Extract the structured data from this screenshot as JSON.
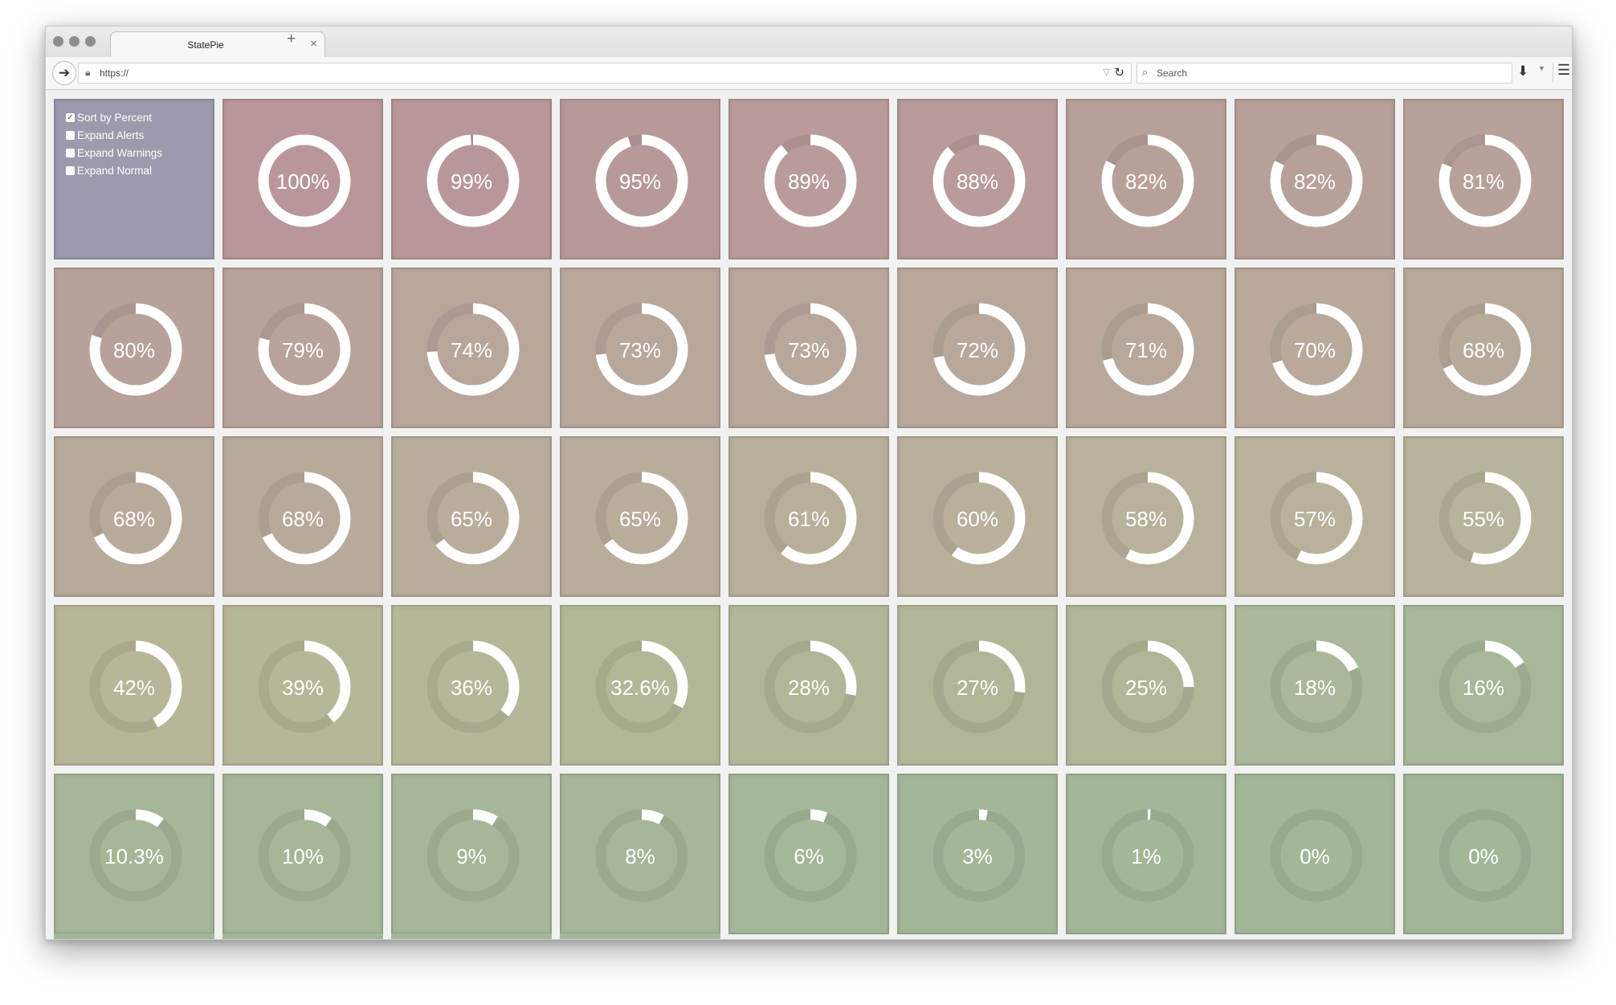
{
  "browser": {
    "tab_title": "StatePie",
    "tab_close": "×",
    "new_tab": "+",
    "url": "https://",
    "search_placeholder": "Search"
  },
  "controls": [
    {
      "label": "Sort by Percent",
      "checked": true
    },
    {
      "label": "Expand Alerts",
      "checked": false
    },
    {
      "label": "Expand Warnings",
      "checked": false
    },
    {
      "label": "Expand Normal",
      "checked": false
    }
  ],
  "pies": [
    {
      "label": "100%",
      "value": 100,
      "color": "#b89699"
    },
    {
      "label": "99%",
      "value": 99,
      "color": "#b8979a"
    },
    {
      "label": "95%",
      "value": 95,
      "color": "#b8999a"
    },
    {
      "label": "89%",
      "value": 89,
      "color": "#b89b9a"
    },
    {
      "label": "88%",
      "value": 88,
      "color": "#b89b9a"
    },
    {
      "label": "82%",
      "value": 82,
      "color": "#b8a09a"
    },
    {
      "label": "82%",
      "value": 82,
      "color": "#b8a09a"
    },
    {
      "label": "81%",
      "value": 81,
      "color": "#b8a19b"
    },
    {
      "label": "80%",
      "value": 80,
      "color": "#b8a19b"
    },
    {
      "label": "79%",
      "value": 79,
      "color": "#b8a29b"
    },
    {
      "label": "74%",
      "value": 74,
      "color": "#b8a69b"
    },
    {
      "label": "73%",
      "value": 73,
      "color": "#b8a79b"
    },
    {
      "label": "73%",
      "value": 73,
      "color": "#b8a79b"
    },
    {
      "label": "72%",
      "value": 72,
      "color": "#b8a89b"
    },
    {
      "label": "71%",
      "value": 71,
      "color": "#b8a89b"
    },
    {
      "label": "70%",
      "value": 70,
      "color": "#b8a99b"
    },
    {
      "label": "68%",
      "value": 68,
      "color": "#b8aa9b"
    },
    {
      "label": "68%",
      "value": 68,
      "color": "#b8aa9b"
    },
    {
      "label": "68%",
      "value": 68,
      "color": "#b8aa9b"
    },
    {
      "label": "65%",
      "value": 65,
      "color": "#b8ac9b"
    },
    {
      "label": "65%",
      "value": 65,
      "color": "#b8ac9b"
    },
    {
      "label": "61%",
      "value": 61,
      "color": "#b8af9b"
    },
    {
      "label": "60%",
      "value": 60,
      "color": "#b8b09b"
    },
    {
      "label": "58%",
      "value": 58,
      "color": "#b8b19b"
    },
    {
      "label": "57%",
      "value": 57,
      "color": "#b8b29b"
    },
    {
      "label": "55%",
      "value": 55,
      "color": "#b8b39b"
    },
    {
      "label": "42%",
      "value": 42,
      "color": "#b8b698"
    },
    {
      "label": "39%",
      "value": 39,
      "color": "#b6b798"
    },
    {
      "label": "36%",
      "value": 36,
      "color": "#b4b798"
    },
    {
      "label": "32.6%",
      "value": 32.6,
      "color": "#b2b798"
    },
    {
      "label": "28%",
      "value": 28,
      "color": "#b0b798"
    },
    {
      "label": "27%",
      "value": 27,
      "color": "#afb798"
    },
    {
      "label": "25%",
      "value": 25,
      "color": "#aeb798"
    },
    {
      "label": "18%",
      "value": 18,
      "color": "#aab798"
    },
    {
      "label": "16%",
      "value": 16,
      "color": "#a8b798"
    },
    {
      "label": "10.3%",
      "value": 10.3,
      "color": "#a6b798"
    },
    {
      "label": "10%",
      "value": 10,
      "color": "#a6b798"
    },
    {
      "label": "9%",
      "value": 9,
      "color": "#a5b798"
    },
    {
      "label": "8%",
      "value": 8,
      "color": "#a5b798"
    },
    {
      "label": "6%",
      "value": 6,
      "color": "#a4b798"
    },
    {
      "label": "3%",
      "value": 3,
      "color": "#a3b798"
    },
    {
      "label": "1%",
      "value": 1,
      "color": "#a3b798"
    },
    {
      "label": "0%",
      "value": 0,
      "color": "#a3b798"
    },
    {
      "label": "0%",
      "value": 0,
      "color": "#a3b798"
    }
  ]
}
